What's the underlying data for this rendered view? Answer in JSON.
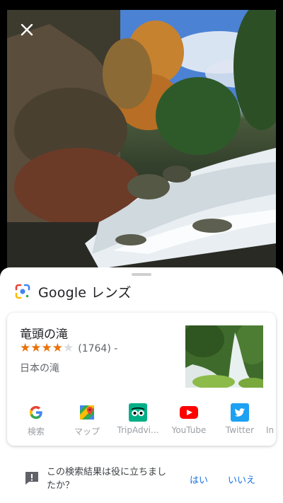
{
  "lens": {
    "title": "Google レンズ"
  },
  "result": {
    "name": "竜頭の滝",
    "rating": 4,
    "max_rating": 5,
    "review_count": "(1764) -",
    "category": "日本の滝"
  },
  "actions": [
    {
      "label": "検索",
      "icon": "google-g-icon"
    },
    {
      "label": "マップ",
      "icon": "google-maps-icon"
    },
    {
      "label": "TripAdvi...",
      "icon": "tripadvisor-icon"
    },
    {
      "label": "YouTube",
      "icon": "youtube-icon"
    },
    {
      "label": "Twitter",
      "icon": "twitter-icon"
    },
    {
      "label": "In",
      "icon": "instagram-icon"
    }
  ],
  "feedback": {
    "question": "この検索結果は役に立ちましたか？",
    "yes": "はい",
    "no": "いいえ"
  },
  "colors": {
    "star_on": "#e8710a",
    "link_blue": "#1a73e8",
    "youtube_red": "#ff0000",
    "twitter_blue": "#1da1f2",
    "tripadvisor_green": "#00af87"
  }
}
